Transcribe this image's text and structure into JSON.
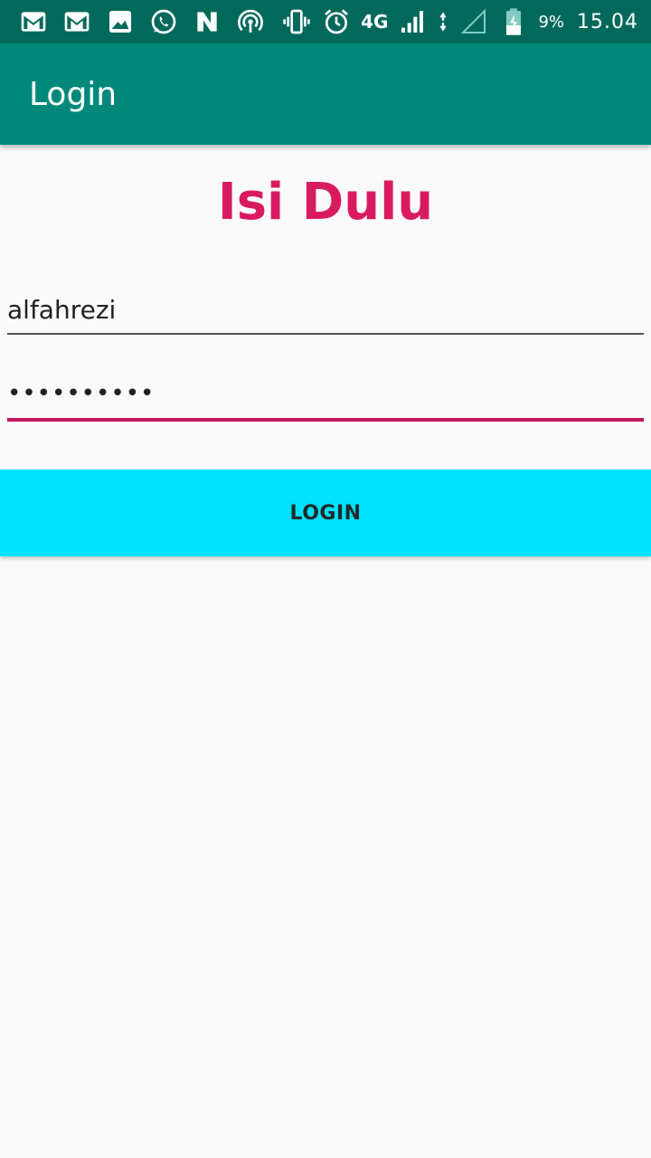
{
  "status_bar": {
    "left_icons": [
      "gmail-icon",
      "gmail-icon",
      "gallery-icon",
      "whatsapp-icon",
      "n-app-icon",
      "hotspot-icon"
    ],
    "right_icons": [
      "vibrate-icon",
      "alarm-icon",
      "network-4g-icon",
      "signal-icon",
      "data-arrows-icon",
      "signal-empty-icon",
      "battery-charging-icon"
    ],
    "network_label": "4G",
    "battery_percent": "9%",
    "time": "15.04"
  },
  "app_bar": {
    "title": "Login"
  },
  "main": {
    "heading": "Isi Dulu",
    "username_value": "alfahrezi",
    "password_value": "••••••••••",
    "login_button_label": "LOGIN"
  },
  "colors": {
    "status_bar": "#00695c",
    "app_bar": "#00897b",
    "heading": "#d81b60",
    "password_underline": "#c2185b",
    "login_button": "#00e0ff",
    "background": "#fafafa"
  }
}
